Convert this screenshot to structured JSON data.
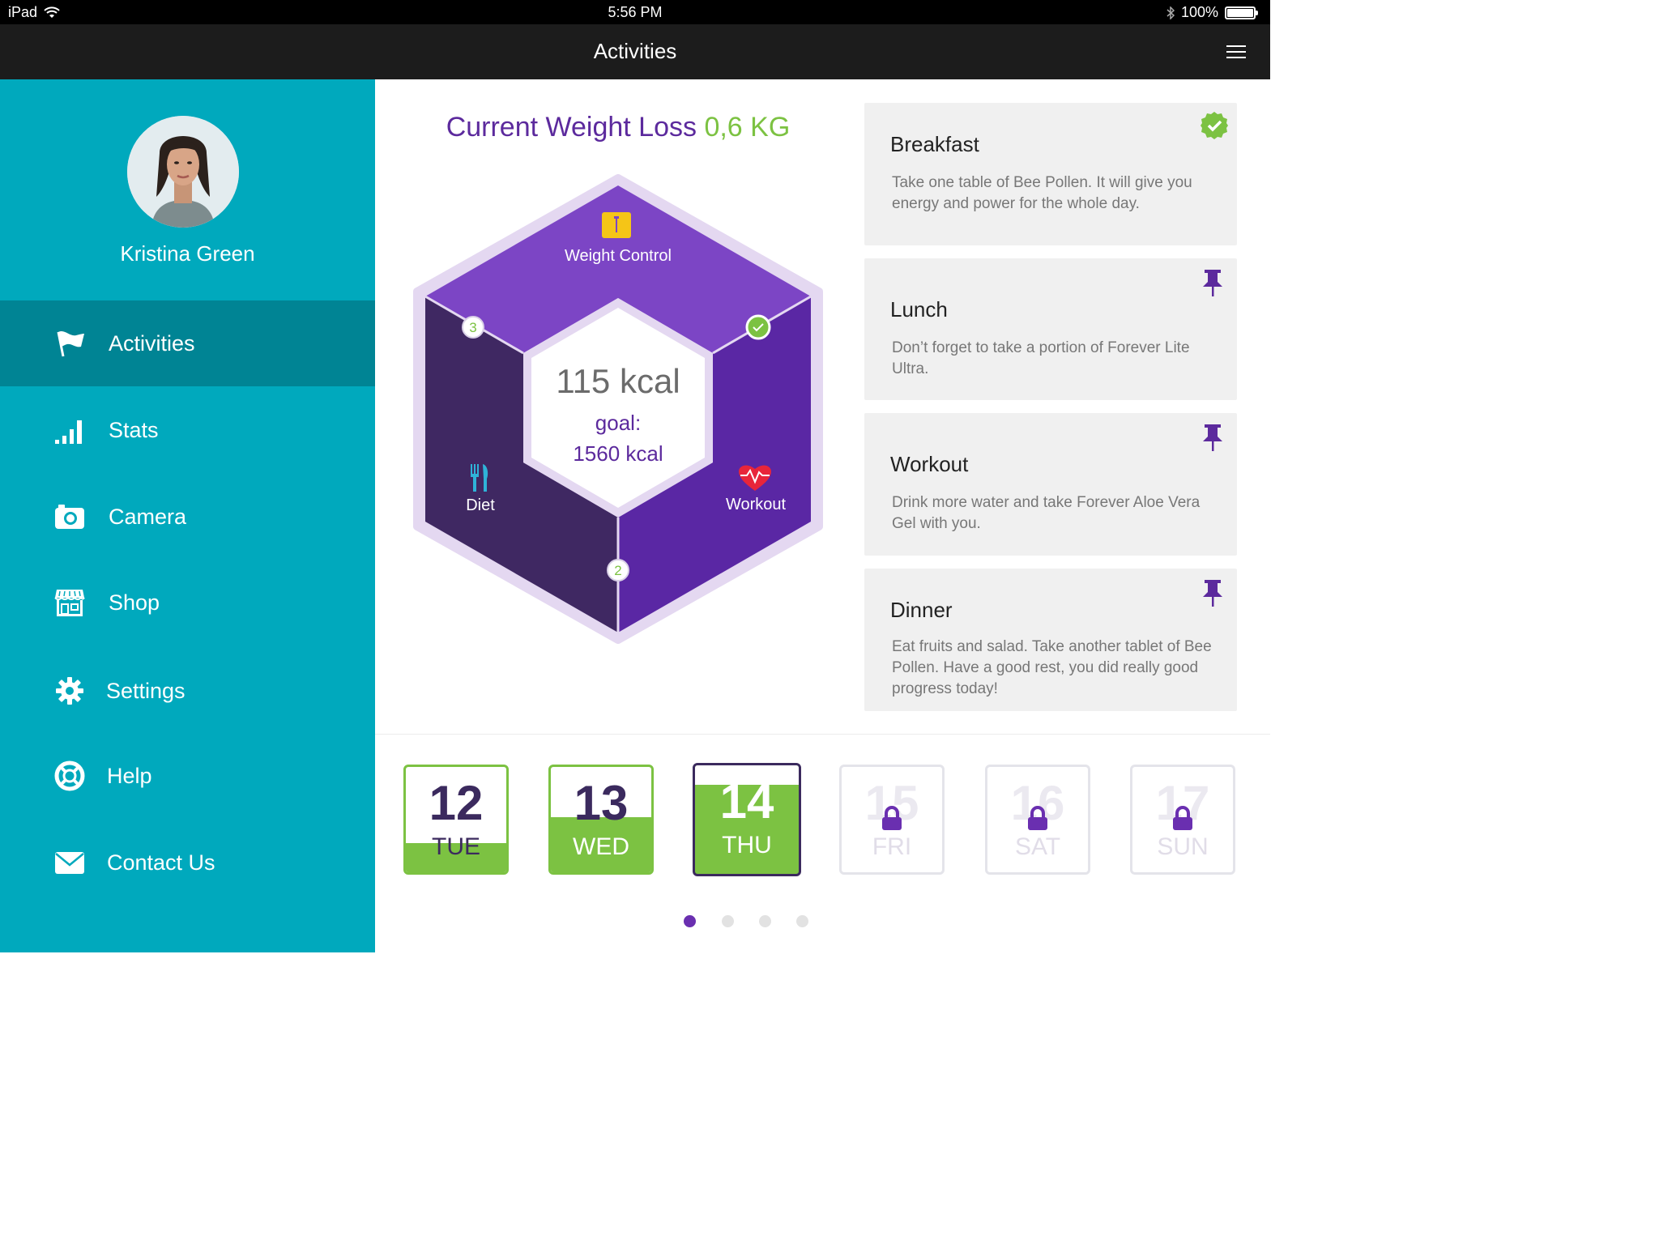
{
  "status_bar": {
    "device": "iPad",
    "time": "5:56 PM",
    "battery": "100%"
  },
  "nav": {
    "title": "Activities",
    "menu_icon": "hamburger-icon"
  },
  "sidebar": {
    "user_name": "Kristina Green",
    "items": [
      {
        "label": "Activities",
        "icon": "flag-icon",
        "active": true
      },
      {
        "label": "Stats",
        "icon": "bars-icon",
        "active": false
      },
      {
        "label": "Camera",
        "icon": "camera-icon",
        "active": false
      },
      {
        "label": "Shop",
        "icon": "shop-icon",
        "active": false
      },
      {
        "label": "Settings",
        "icon": "gear-icon",
        "active": false
      },
      {
        "label": "Help",
        "icon": "lifebuoy-icon",
        "active": false
      },
      {
        "label": "Contact Us",
        "icon": "mail-icon",
        "active": false
      }
    ]
  },
  "weight_loss": {
    "label": "Current Weight Loss",
    "value": "0,6 KG"
  },
  "hexagon": {
    "kcal": "115 kcal",
    "goal_label": "goal:",
    "goal_value": "1560 kcal",
    "segments": {
      "weight_control": "Weight Control",
      "diet": "Diet",
      "workout": "Workout"
    },
    "badges": {
      "diet_weight": "3",
      "bottom": "2"
    }
  },
  "cards": [
    {
      "title": "Breakfast",
      "text": "Take one table of Bee Pollen. It will give you energy and power for the whole day.",
      "icon": "check-circle-icon"
    },
    {
      "title": "Lunch",
      "text": "Don’t forget to take a portion of Forever Lite Ultra.",
      "icon": "pin-icon"
    },
    {
      "title": "Workout",
      "text": "Drink more water and take Forever Aloe Vera Gel with you.",
      "icon": "pin-icon"
    },
    {
      "title": "Dinner",
      "text": "Eat fruits and salad. Take another tablet of Bee Pollen. Have a good rest, you did really good progress today!",
      "icon": "pin-icon"
    }
  ],
  "days": [
    {
      "num": "12",
      "weekday": "TUE",
      "state": "done",
      "progress": 0.28
    },
    {
      "num": "13",
      "weekday": "WED",
      "state": "done",
      "progress": 0.52
    },
    {
      "num": "14",
      "weekday": "THU",
      "state": "today",
      "progress": 0.82
    },
    {
      "num": "15",
      "weekday": "FRI",
      "state": "locked"
    },
    {
      "num": "16",
      "weekday": "SAT",
      "state": "locked"
    },
    {
      "num": "17",
      "weekday": "SUN",
      "state": "locked"
    }
  ],
  "pagination": {
    "count": 4,
    "active": 1
  },
  "colors": {
    "sidebar": "#00a9bd",
    "sidebar_active": "#008494",
    "purple": "#5c2a9d",
    "green": "#7cc242"
  }
}
